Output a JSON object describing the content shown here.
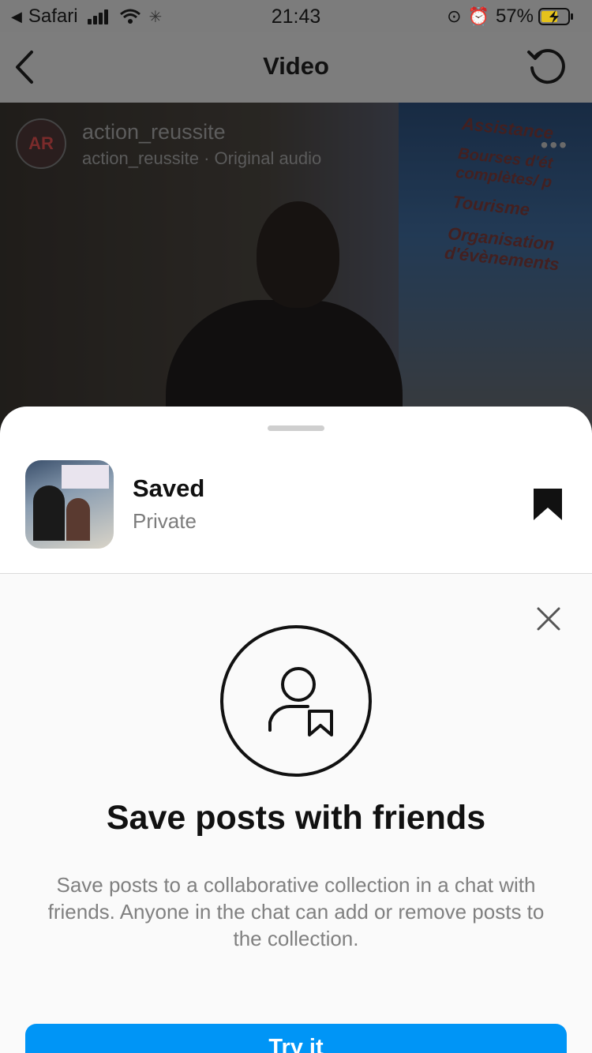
{
  "status_bar": {
    "back_app": "Safari",
    "time": "21:43",
    "battery": "57%"
  },
  "nav": {
    "title": "Video"
  },
  "post": {
    "username": "action_reussite",
    "subtitle": "action_reussite · Original audio",
    "avatar_text": "AR",
    "poster_lines": [
      "Assistance",
      "Bourses d'ét",
      "complètes/ p",
      "Tourisme",
      "Organisation",
      "d'évènements"
    ]
  },
  "save_panel": {
    "title": "Saved",
    "subtitle": "Private"
  },
  "promo": {
    "title": "Save posts with friends",
    "description": "Save posts to a collaborative collection in a chat with friends. Anyone in the chat can add or remove posts to the collection.",
    "button_label": "Try it"
  },
  "colors": {
    "accent": "#0095f6"
  }
}
